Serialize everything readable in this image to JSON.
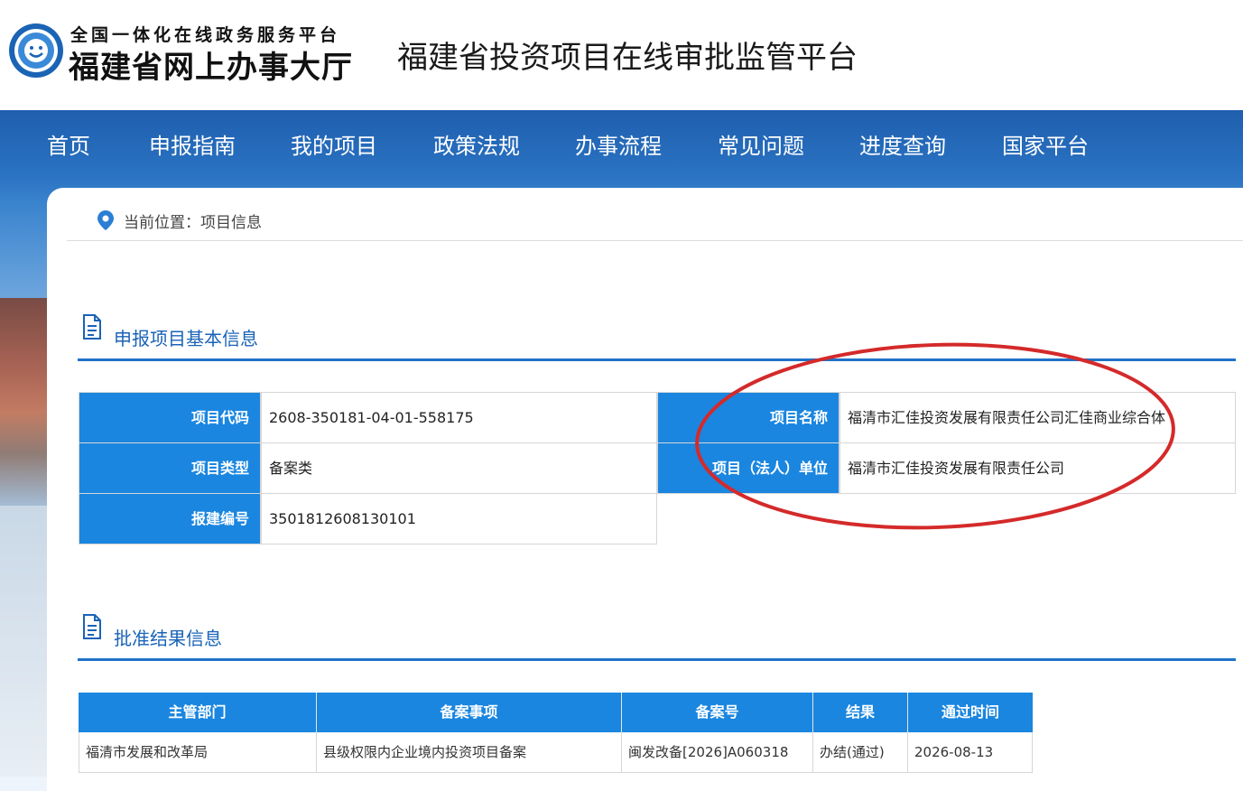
{
  "header": {
    "logo_small": "全国一体化在线政务服务平台",
    "logo_big": "福建省网上办事大厅",
    "platform_title": "福建省投资项目在线审批监管平台"
  },
  "nav": {
    "items": [
      "首页",
      "申报指南",
      "我的项目",
      "政策法规",
      "办事流程",
      "常见问题",
      "进度查询",
      "国家平台"
    ]
  },
  "breadcrumb": {
    "text": "当前位置：项目信息"
  },
  "basic_info": {
    "title": "申报项目基本信息",
    "project_code_label": "项目代码",
    "project_code": "2608-350181-04-01-558175",
    "project_name_label": "项目名称",
    "project_name": "福清市汇佳投资发展有限责任公司汇佳商业综合体",
    "project_type_label": "项目类型",
    "project_type": "备案类",
    "legal_unit_label": "项目（法人）单位",
    "legal_unit": "福清市汇佳投资发展有限责任公司",
    "build_no_label": "报建编号",
    "build_no": "3501812608130101"
  },
  "approval": {
    "title": "批准结果信息",
    "headers": [
      "主管部门",
      "备案事项",
      "备案号",
      "结果",
      "通过时间"
    ],
    "rows": [
      [
        "福清市发展和改革局",
        "县级权限内企业境内投资项目备案",
        "闽发改备[2026]A060318",
        "办结(通过)",
        "2026-08-13"
      ]
    ]
  },
  "colors": {
    "nav_blue": "#1f5fae",
    "label_blue": "#1a86e0",
    "section_blue": "#1a63b8",
    "annotation_red": "#d42a2a"
  }
}
